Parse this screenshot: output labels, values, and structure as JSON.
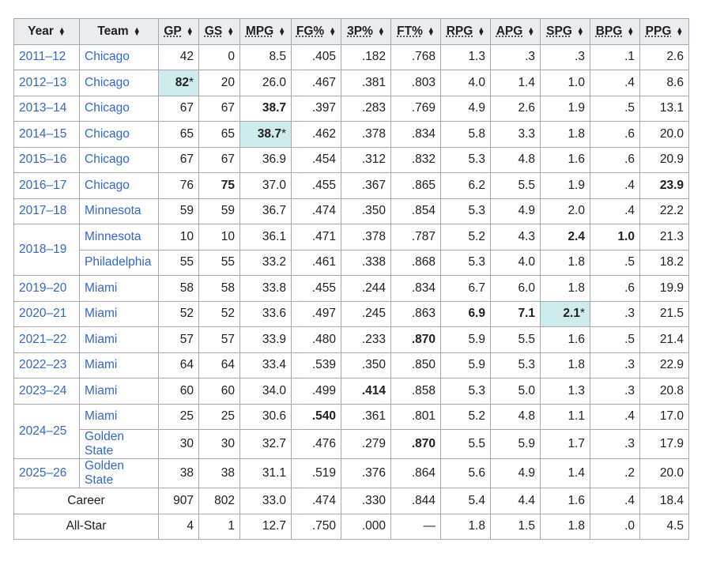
{
  "columns": [
    {
      "key": "Year",
      "abbr": false
    },
    {
      "key": "Team",
      "abbr": false
    },
    {
      "key": "GP",
      "abbr": true
    },
    {
      "key": "GS",
      "abbr": true
    },
    {
      "key": "MPG",
      "abbr": true
    },
    {
      "key": "FG%",
      "abbr": true
    },
    {
      "key": "3P%",
      "abbr": true
    },
    {
      "key": "FT%",
      "abbr": true
    },
    {
      "key": "RPG",
      "abbr": true
    },
    {
      "key": "APG",
      "abbr": true
    },
    {
      "key": "SPG",
      "abbr": true
    },
    {
      "key": "BPG",
      "abbr": true
    },
    {
      "key": "PPG",
      "abbr": true
    }
  ],
  "sort_icon": "sort-arrows-icon",
  "lead_color": "#cfecec",
  "link_color": "#3366cc",
  "seasons": [
    {
      "year": "2011–12",
      "rows": [
        {
          "team": "Chicago",
          "stats": [
            "42",
            "0",
            "8.5",
            ".405",
            ".182",
            ".768",
            "1.3",
            ".3",
            ".3",
            ".1",
            "2.6"
          ],
          "bold": [],
          "lead": []
        }
      ]
    },
    {
      "year": "2012–13",
      "rows": [
        {
          "team": "Chicago",
          "stats": [
            "82*",
            "20",
            "26.0",
            ".467",
            ".381",
            ".803",
            "4.0",
            "1.4",
            "1.0",
            ".4",
            "8.6"
          ],
          "bold": [
            0
          ],
          "lead": [
            0
          ]
        }
      ]
    },
    {
      "year": "2013–14",
      "rows": [
        {
          "team": "Chicago",
          "stats": [
            "67",
            "67",
            "38.7",
            ".397",
            ".283",
            ".769",
            "4.9",
            "2.6",
            "1.9",
            ".5",
            "13.1"
          ],
          "bold": [
            2
          ],
          "lead": []
        }
      ]
    },
    {
      "year": "2014–15",
      "rows": [
        {
          "team": "Chicago",
          "stats": [
            "65",
            "65",
            "38.7*",
            ".462",
            ".378",
            ".834",
            "5.8",
            "3.3",
            "1.8",
            ".6",
            "20.0"
          ],
          "bold": [
            2
          ],
          "lead": [
            2
          ]
        }
      ]
    },
    {
      "year": "2015–16",
      "rows": [
        {
          "team": "Chicago",
          "stats": [
            "67",
            "67",
            "36.9",
            ".454",
            ".312",
            ".832",
            "5.3",
            "4.8",
            "1.6",
            ".6",
            "20.9"
          ],
          "bold": [],
          "lead": []
        }
      ]
    },
    {
      "year": "2016–17",
      "rows": [
        {
          "team": "Chicago",
          "stats": [
            "76",
            "75",
            "37.0",
            ".455",
            ".367",
            ".865",
            "6.2",
            "5.5",
            "1.9",
            ".4",
            "23.9"
          ],
          "bold": [
            1,
            10
          ],
          "lead": []
        }
      ]
    },
    {
      "year": "2017–18",
      "rows": [
        {
          "team": "Minnesota",
          "stats": [
            "59",
            "59",
            "36.7",
            ".474",
            ".350",
            ".854",
            "5.3",
            "4.9",
            "2.0",
            ".4",
            "22.2"
          ],
          "bold": [],
          "lead": []
        }
      ]
    },
    {
      "year": "2018–19",
      "rows": [
        {
          "team": "Minnesota",
          "stats": [
            "10",
            "10",
            "36.1",
            ".471",
            ".378",
            ".787",
            "5.2",
            "4.3",
            "2.4",
            "1.0",
            "21.3"
          ],
          "bold": [
            8,
            9
          ],
          "lead": []
        },
        {
          "team": "Philadelphia",
          "stats": [
            "55",
            "55",
            "33.2",
            ".461",
            ".338",
            ".868",
            "5.3",
            "4.0",
            "1.8",
            ".5",
            "18.2"
          ],
          "bold": [],
          "lead": []
        }
      ]
    },
    {
      "year": "2019–20",
      "rows": [
        {
          "team": "Miami",
          "stats": [
            "58",
            "58",
            "33.8",
            ".455",
            ".244",
            ".834",
            "6.7",
            "6.0",
            "1.8",
            ".6",
            "19.9"
          ],
          "bold": [],
          "lead": []
        }
      ]
    },
    {
      "year": "2020–21",
      "rows": [
        {
          "team": "Miami",
          "stats": [
            "52",
            "52",
            "33.6",
            ".497",
            ".245",
            ".863",
            "6.9",
            "7.1",
            "2.1*",
            ".3",
            "21.5"
          ],
          "bold": [
            6,
            7
          ],
          "lead": [
            8
          ]
        }
      ]
    },
    {
      "year": "2021–22",
      "rows": [
        {
          "team": "Miami",
          "stats": [
            "57",
            "57",
            "33.9",
            ".480",
            ".233",
            ".870",
            "5.9",
            "5.5",
            "1.6",
            ".5",
            "21.4"
          ],
          "bold": [
            5
          ],
          "lead": []
        }
      ]
    },
    {
      "year": "2022–23",
      "rows": [
        {
          "team": "Miami",
          "stats": [
            "64",
            "64",
            "33.4",
            ".539",
            ".350",
            ".850",
            "5.9",
            "5.3",
            "1.8",
            ".3",
            "22.9"
          ],
          "bold": [],
          "lead": []
        }
      ]
    },
    {
      "year": "2023–24",
      "rows": [
        {
          "team": "Miami",
          "stats": [
            "60",
            "60",
            "34.0",
            ".499",
            ".414",
            ".858",
            "5.3",
            "5.0",
            "1.3",
            ".3",
            "20.8"
          ],
          "bold": [
            4
          ],
          "lead": []
        }
      ]
    },
    {
      "year": "2024–25",
      "rows": [
        {
          "team": "Miami",
          "stats": [
            "25",
            "25",
            "30.6",
            ".540",
            ".361",
            ".801",
            "5.2",
            "4.8",
            "1.1",
            ".4",
            "17.0"
          ],
          "bold": [
            3
          ],
          "lead": []
        },
        {
          "team": "Golden State",
          "stats": [
            "30",
            "30",
            "32.7",
            ".476",
            ".279",
            ".870",
            "5.5",
            "5.9",
            "1.7",
            ".3",
            "17.9"
          ],
          "bold": [
            5
          ],
          "lead": []
        }
      ]
    },
    {
      "year": "2025–26",
      "rows": [
        {
          "team": "Golden State",
          "stats": [
            "38",
            "38",
            "31.1",
            ".519",
            ".376",
            ".864",
            "5.6",
            "4.9",
            "1.4",
            ".2",
            "20.0"
          ],
          "bold": [],
          "lead": []
        }
      ]
    }
  ],
  "totals": [
    {
      "label": "Career",
      "stats": [
        "907",
        "802",
        "33.0",
        ".474",
        ".330",
        ".844",
        "5.4",
        "4.4",
        "1.6",
        ".4",
        "18.4"
      ]
    },
    {
      "label": "All-Star",
      "stats": [
        "4",
        "1",
        "12.7",
        ".750",
        ".000",
        "—",
        "1.8",
        "1.5",
        "1.8",
        ".0",
        "4.5"
      ]
    }
  ]
}
